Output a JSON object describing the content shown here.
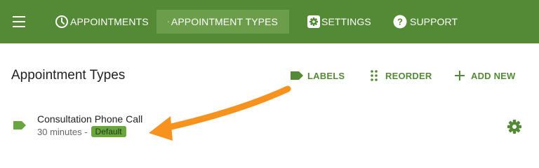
{
  "navbar": {
    "items": [
      {
        "label": "APPOINTMENTS",
        "icon": "clock-icon"
      },
      {
        "label": "APPOINTMENT TYPES",
        "icon": "list-icon",
        "active": true
      },
      {
        "label": "SETTINGS",
        "icon": "gear-icon"
      },
      {
        "label": "SUPPORT",
        "icon": "help-icon"
      }
    ]
  },
  "main": {
    "title": "Appointment Types",
    "actions": {
      "labels": "LABELS",
      "reorder": "REORDER",
      "add_new": "ADD NEW"
    },
    "appointment_types": [
      {
        "name": "Consultation Phone Call",
        "duration": "30 minutes -",
        "badge": "Default"
      }
    ]
  },
  "colors": {
    "navbar": "#548a35",
    "navbar_active": "#6c9d4b",
    "accent": "#548a35",
    "badge": "#6aa640",
    "annotation_arrow": "#f7921e"
  }
}
